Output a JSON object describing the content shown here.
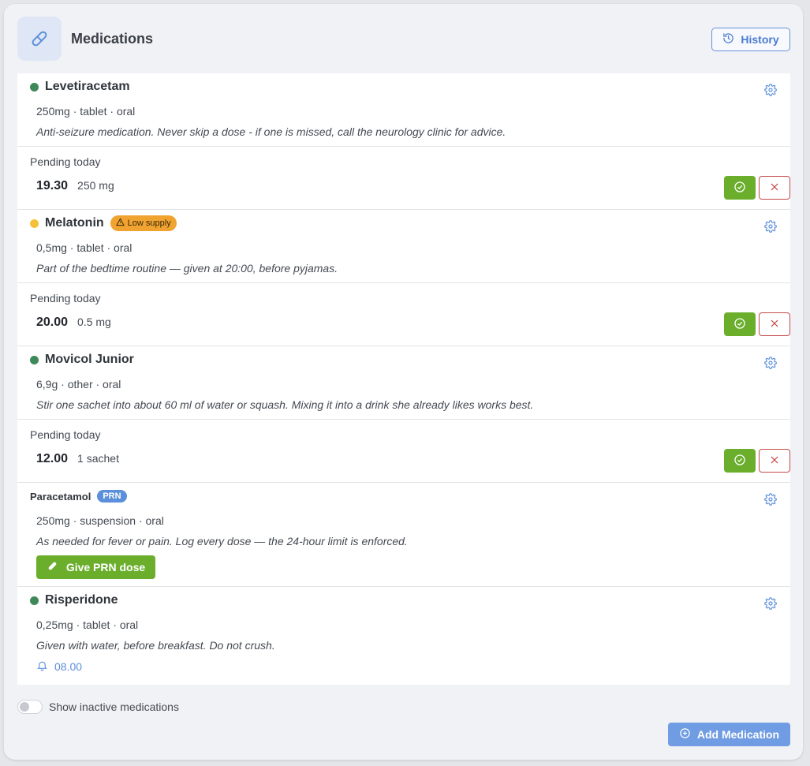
{
  "header": {
    "title": "Medications",
    "history_label": "History"
  },
  "medications": [
    {
      "name": "Levetiracetam",
      "details": "250mg · tablet · oral",
      "note": "Anti-seizure medication. Never skip a dose - if one is missed, call the neurology clinic for advice.",
      "pending_label": "Pending today",
      "dose_time": "19.30",
      "dose_amount": "250 mg"
    },
    {
      "name": "Melatonin",
      "badge": "Low supply",
      "details": "0,5mg · tablet · oral",
      "note": "Part of the bedtime routine — given at 20:00, before pyjamas.",
      "pending_label": "Pending today",
      "dose_time": "20.00",
      "dose_amount": "0.5 mg"
    },
    {
      "name": "Movicol Junior",
      "details": "6,9g · other · oral",
      "note": "Stir one sachet into about 60 ml of water or squash. Mixing it into a drink she already likes works best.",
      "pending_label": "Pending today",
      "dose_time": "12.00",
      "dose_amount": "1 sachet"
    },
    {
      "name": "Paracetamol",
      "badge": "PRN",
      "details": "250mg · suspension · oral",
      "note": "As needed for fever or pain. Log every dose — the 24-hour limit is enforced.",
      "prn_button_label": "Give PRN dose"
    },
    {
      "name": "Risperidone",
      "details": "0,25mg · tablet · oral",
      "note": "Given with water, before breakfast. Do not crush.",
      "reminder_time": "08.00"
    }
  ],
  "footer": {
    "toggle_label": "Show inactive medications",
    "add_label": "Add Medication"
  },
  "colors": {
    "active_dot": "#3d8a58",
    "warning_dot": "#f5c13b",
    "confirm_green": "#6aae2c",
    "skip_red": "#c44a4a",
    "accent_blue": "#5b8fd9"
  }
}
